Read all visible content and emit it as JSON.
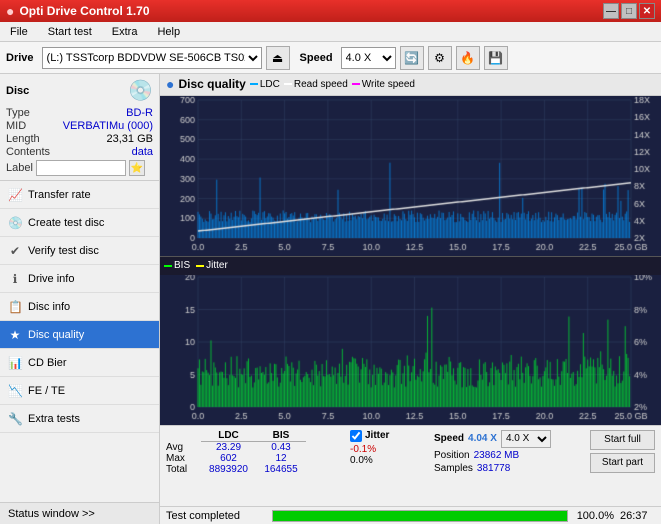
{
  "titlebar": {
    "title": "Opti Drive Control 1.70",
    "icon": "●",
    "min": "—",
    "max": "□",
    "close": "✕"
  },
  "menubar": {
    "items": [
      "File",
      "Start test",
      "Extra",
      "Help"
    ]
  },
  "toolbar": {
    "drive_label": "Drive",
    "drive_value": "(L:)  TSSTcorp BDDVDW SE-506CB TS02",
    "speed_label": "Speed",
    "speed_value": "4.0 X"
  },
  "disc": {
    "title": "Disc",
    "type_label": "Type",
    "type_val": "BD-R",
    "mid_label": "MID",
    "mid_val": "VERBATIMu (000)",
    "length_label": "Length",
    "length_val": "23,31 GB",
    "contents_label": "Contents",
    "contents_val": "data",
    "label_label": "Label"
  },
  "nav": {
    "items": [
      {
        "id": "transfer-rate",
        "label": "Transfer rate",
        "icon": "📈"
      },
      {
        "id": "create-test-disc",
        "label": "Create test disc",
        "icon": "💿"
      },
      {
        "id": "verify-test-disc",
        "label": "Verify test disc",
        "icon": "✔"
      },
      {
        "id": "drive-info",
        "label": "Drive info",
        "icon": "ℹ"
      },
      {
        "id": "disc-info",
        "label": "Disc info",
        "icon": "📋"
      },
      {
        "id": "disc-quality",
        "label": "Disc quality",
        "icon": "★",
        "active": true
      },
      {
        "id": "cd-bler",
        "label": "CD Bier",
        "icon": "📊"
      },
      {
        "id": "fe-te",
        "label": "FE / TE",
        "icon": "📉"
      },
      {
        "id": "extra-tests",
        "label": "Extra tests",
        "icon": "🔧"
      }
    ],
    "status_window": "Status window >>"
  },
  "chart": {
    "title": "Disc quality",
    "legend_ldc": "LDC",
    "legend_read": "Read speed",
    "legend_write": "Write speed",
    "legend_bis": "BIS",
    "legend_jitter": "Jitter",
    "top": {
      "y_max": 700,
      "y_labels": [
        "700",
        "600",
        "500",
        "400",
        "300",
        "200",
        "100"
      ],
      "y_right": [
        "18X",
        "16X",
        "14X",
        "12X",
        "10X",
        "8X",
        "6X",
        "4X",
        "2X"
      ],
      "x_labels": [
        "0.0",
        "2.5",
        "5.0",
        "7.5",
        "10.0",
        "12.5",
        "15.0",
        "17.5",
        "20.0",
        "22.5",
        "25.0 GB"
      ]
    },
    "bottom": {
      "y_max": 20,
      "y_labels": [
        "20",
        "15",
        "10",
        "5"
      ],
      "y_right": [
        "10%",
        "8%",
        "6%",
        "4%",
        "2%"
      ],
      "x_labels": [
        "0.0",
        "2.5",
        "5.0",
        "7.5",
        "10.0",
        "12.5",
        "15.0",
        "17.5",
        "20.0",
        "22.5",
        "25.0 GB"
      ]
    }
  },
  "stats": {
    "avg_label": "Avg",
    "max_label": "Max",
    "total_label": "Total",
    "ldc_header": "LDC",
    "bis_header": "BIS",
    "jitter_header": "Jitter",
    "speed_header": "Speed",
    "position_header": "Position",
    "samples_header": "Samples",
    "avg_ldc": "23.29",
    "avg_bis": "0.43",
    "avg_jitter": "-0.1%",
    "max_ldc": "602",
    "max_bis": "12",
    "max_jitter": "0.0%",
    "total_ldc": "8893920",
    "total_bis": "164655",
    "speed_val": "4.04 X",
    "speed_select": "4.0 X",
    "position_val": "23862 MB",
    "samples_val": "381778",
    "btn_start_full": "Start full",
    "btn_start_part": "Start part"
  },
  "progressbar": {
    "status": "Test completed",
    "pct": "100.0%",
    "time": "26:37"
  }
}
